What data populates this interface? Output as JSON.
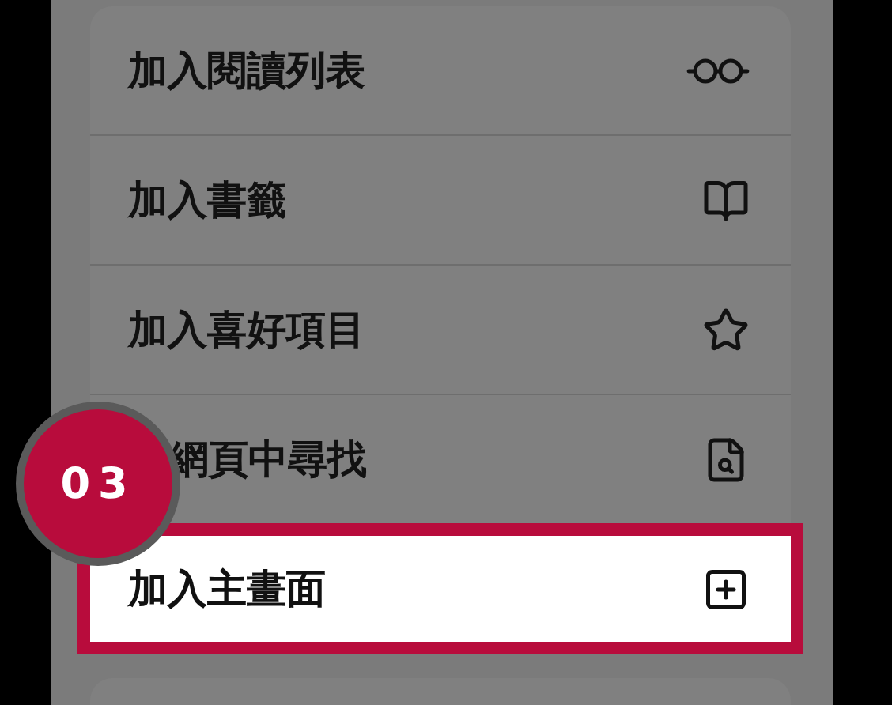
{
  "menu": {
    "items": [
      {
        "label": "加入閱讀列表",
        "highlighted": false
      },
      {
        "label": "加入書籤",
        "highlighted": false
      },
      {
        "label": "加入喜好項目",
        "highlighted": false
      },
      {
        "label": "網頁中尋找",
        "highlighted": false
      },
      {
        "label": "加入主畫面",
        "highlighted": true
      }
    ]
  },
  "callout": {
    "label": "03"
  }
}
